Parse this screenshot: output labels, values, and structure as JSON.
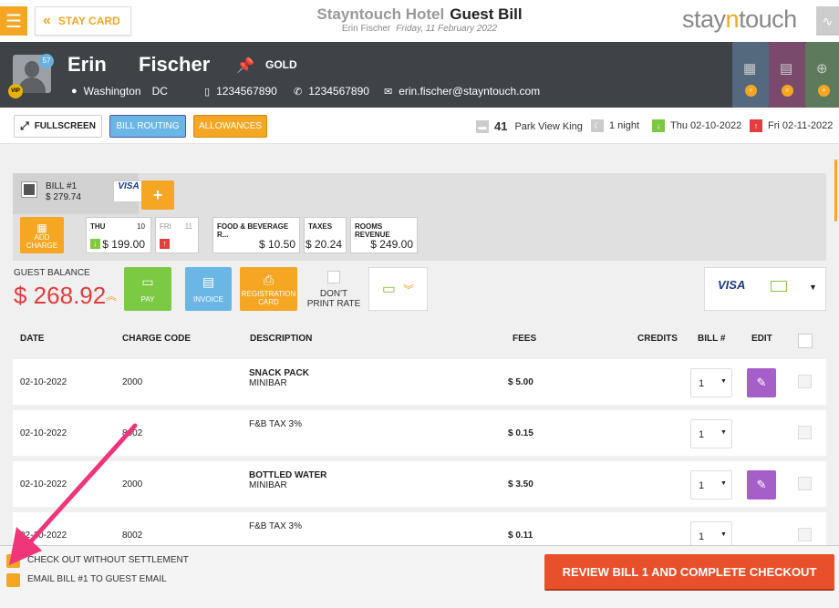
{
  "header": {
    "staycard_label": "STAY CARD",
    "hotel_name": "Stayntouch Hotel",
    "page_title": "Guest Bill",
    "guest_name": "Erin Fischer",
    "date": "Friday, 11 February 2022",
    "logo_prefix": "stay",
    "logo_accent": "n",
    "logo_suffix": "touch"
  },
  "guest": {
    "first_name": "Erin",
    "last_name": "Fischer",
    "badge_count": "57",
    "vip": "VIP",
    "tier": "GOLD",
    "city": "Washington",
    "state": "DC",
    "phone_mobile": "1234567890",
    "phone_home": "1234567890",
    "email": "erin.fischer@stayntouch.com"
  },
  "actions": {
    "fullscreen": "FULLSCREEN",
    "bill_routing": "BILL ROUTING",
    "allowances": "ALLOWANCES"
  },
  "stay": {
    "room_number": "41",
    "room_type": "Park View King",
    "nights": "1 night",
    "arrival": "Thu 02-10-2022",
    "departure": "Fri 02-11-2022"
  },
  "bill": {
    "label": "BILL #1",
    "amount": "$ 279.74",
    "card": "VISA",
    "add_bill": "+",
    "add_charge": "ADD CHARGE",
    "days": [
      {
        "day": "THU",
        "num": "10",
        "value": "$ 199.00"
      },
      {
        "day": "FRI",
        "num": "11",
        "value": ""
      }
    ],
    "categories": [
      {
        "title": "FOOD & BEVERAGE R...",
        "value": "$ 10.50"
      },
      {
        "title": "TAXES",
        "value": "$ 20.24"
      },
      {
        "title": "ROOMS REVENUE",
        "value": "$ 249.00"
      }
    ]
  },
  "balance": {
    "label": "GUEST BALANCE",
    "value": "$ 268.92",
    "pay": "PAY",
    "invoice": "INVOICE",
    "registration": "REGISTRATION CARD",
    "dont_print_rate": "DON'T PRINT RATE",
    "card": "VISA"
  },
  "table": {
    "headers": {
      "date": "DATE",
      "charge_code": "CHARGE CODE",
      "description": "DESCRIPTION",
      "fees": "FEES",
      "credits": "CREDITS",
      "bill": "BILL #",
      "edit": "EDIT"
    },
    "rows": [
      {
        "date": "02-10-2022",
        "code": "2000",
        "desc": "SNACK PACK",
        "sub": "MINIBAR",
        "fee": "$ 5.00",
        "bill": "1"
      },
      {
        "date": "02-10-2022",
        "code": "8002",
        "desc": "F&B TAX 3%",
        "sub": "",
        "fee": "$ 0.15",
        "bill": "1"
      },
      {
        "date": "02-10-2022",
        "code": "2000",
        "desc": "BOTTLED WATER",
        "sub": "MINIBAR",
        "fee": "$ 3.50",
        "bill": "1"
      },
      {
        "date": "02-10-2022",
        "code": "8002",
        "desc": "F&B TAX 3%",
        "sub": "",
        "fee": "$ 0.11",
        "bill": "1"
      }
    ]
  },
  "footer": {
    "checkout_without_settlement": "CHECK OUT WITHOUT SETTLEMENT",
    "email_bill": "EMAIL BILL #1 TO GUEST EMAIL",
    "review_button": "REVIEW BILL 1 AND COMPLETE CHECKOUT"
  },
  "colors": {
    "accent": "#f5a623",
    "balance": "#e43d3d",
    "review": "#e8502b",
    "pay": "#7cc943",
    "invoice": "#6ab7e6",
    "edit": "#a65fc9",
    "annotation_arrow": "#f0357a"
  }
}
